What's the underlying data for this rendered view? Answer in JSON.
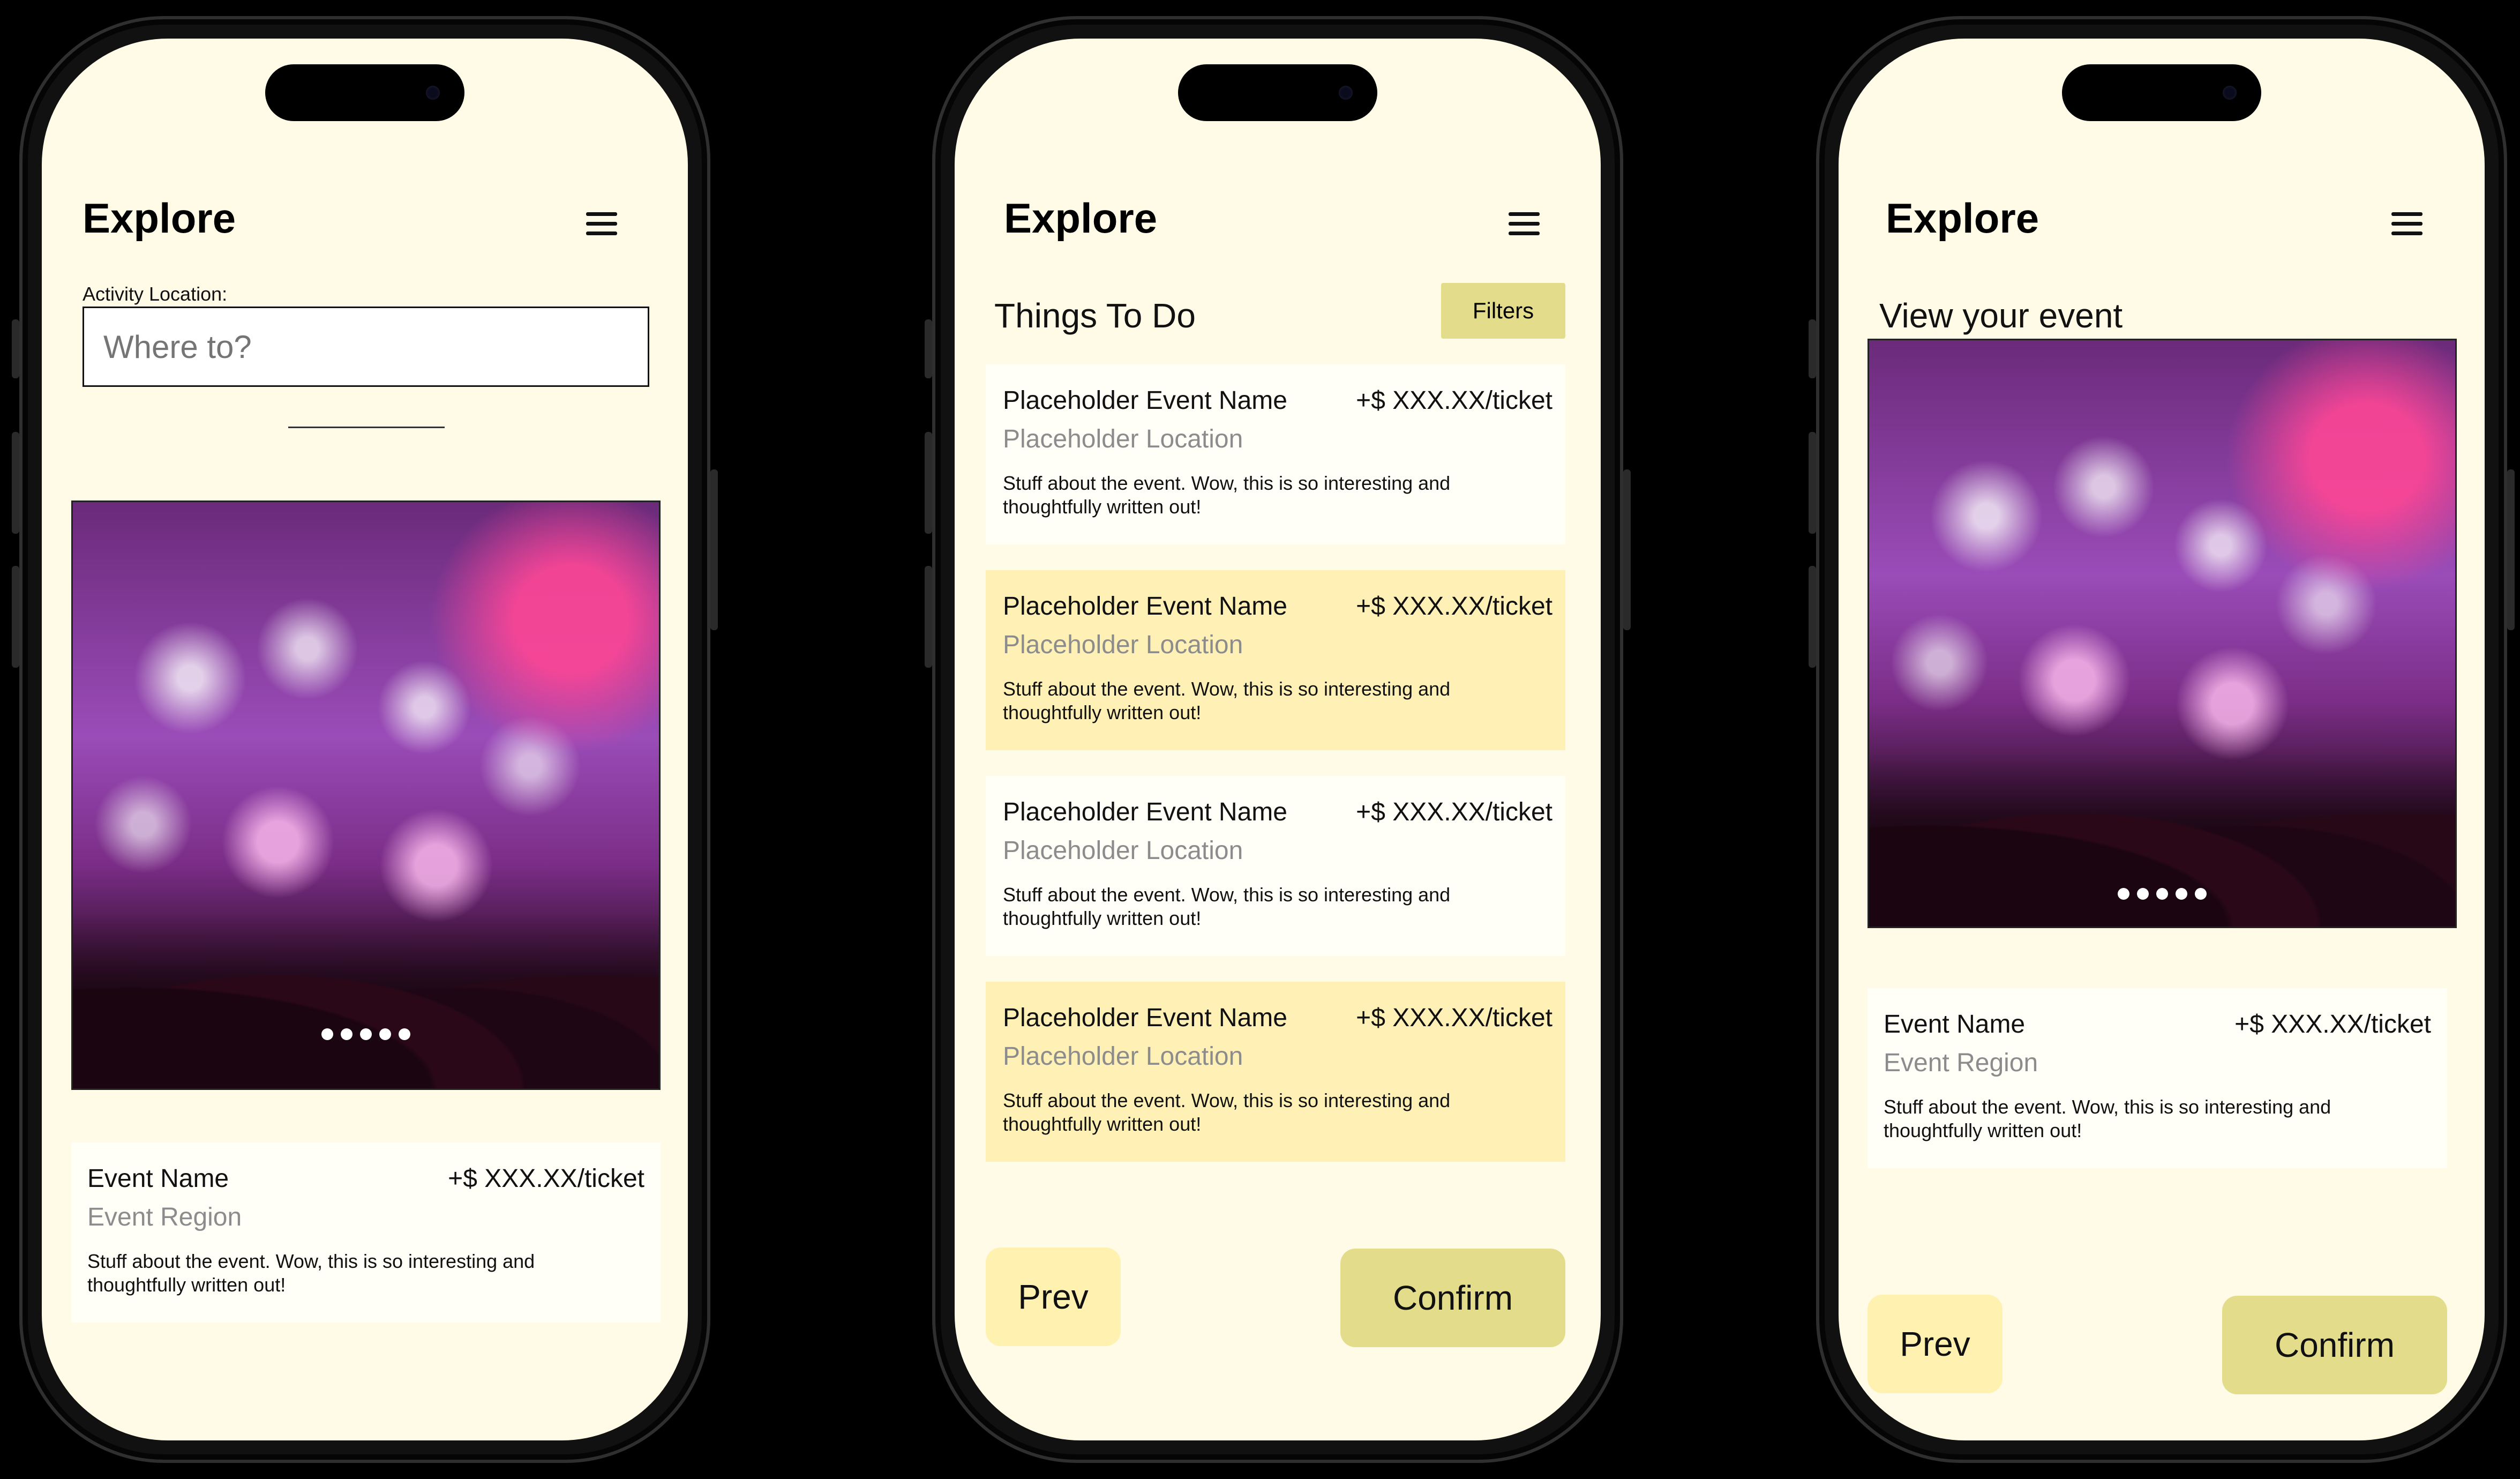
{
  "app": {
    "title": "Explore"
  },
  "screen1": {
    "location_label": "Activity Location:",
    "location_placeholder": "Where to?",
    "event": {
      "name": "Event Name",
      "price": "+$ XXX.XX/ticket",
      "region": "Event Region",
      "description": "Stuff about the event. Wow, this is so interesting and thoughtfully written out!"
    }
  },
  "screen2": {
    "section_title": "Things To Do",
    "filters_label": "Filters",
    "events": [
      {
        "name": "Placeholder Event Name",
        "price": "+$ XXX.XX/ticket",
        "location": "Placeholder Location",
        "description": "Stuff about the event. Wow, this is so interesting and thoughtfully written out!"
      },
      {
        "name": "Placeholder Event Name",
        "price": "+$ XXX.XX/ticket",
        "location": "Placeholder Location",
        "description": "Stuff about the event. Wow, this is so interesting and thoughtfully written out!"
      },
      {
        "name": "Placeholder Event Name",
        "price": "+$ XXX.XX/ticket",
        "location": "Placeholder Location",
        "description": "Stuff about the event. Wow, this is so interesting and thoughtfully written out!"
      },
      {
        "name": "Placeholder Event Name",
        "price": "+$ XXX.XX/ticket",
        "location": "Placeholder Location",
        "description": "Stuff about the event. Wow, this is so interesting and thoughtfully written out!"
      }
    ],
    "prev_label": "Prev",
    "confirm_label": "Confirm"
  },
  "screen3": {
    "section_title": "View your event",
    "event": {
      "name": "Event Name",
      "price": "+$ XXX.XX/ticket",
      "region": "Event Region",
      "description": "Stuff about the event. Wow, this is so interesting and thoughtfully written out!"
    },
    "prev_label": "Prev",
    "confirm_label": "Confirm"
  },
  "icons": {
    "menu": "hamburger-menu-icon",
    "carousel": "carousel-dots"
  },
  "colors": {
    "background": "#fffbe6",
    "accent": "#e3dd8b",
    "highlight": "#fff1b5"
  }
}
